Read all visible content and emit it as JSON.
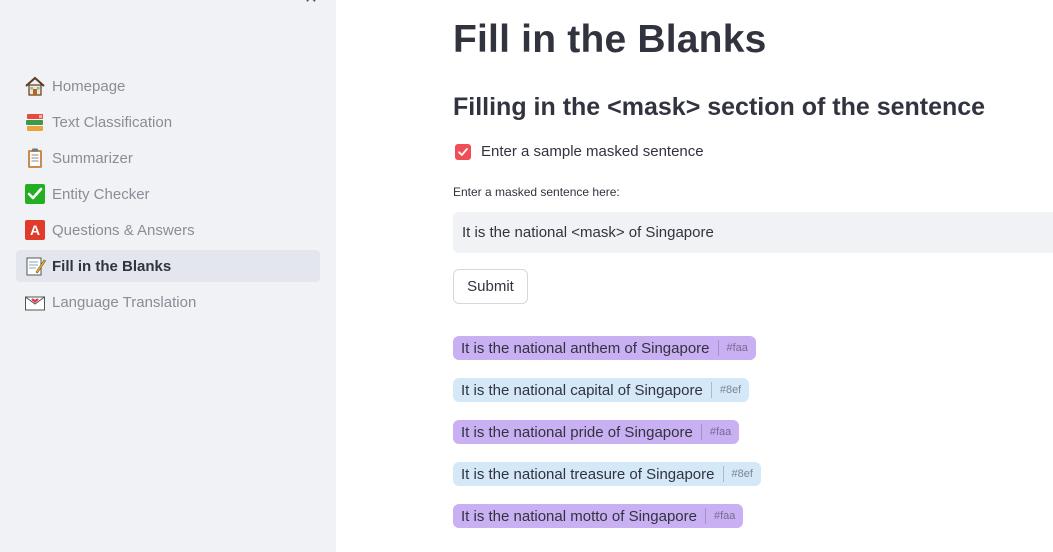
{
  "sidebar": {
    "items": [
      {
        "label": "Homepage",
        "icon": "house-icon",
        "active": false
      },
      {
        "label": "Text Classification",
        "icon": "books-icon",
        "active": false
      },
      {
        "label": "Summarizer",
        "icon": "clipboard-icon",
        "active": false
      },
      {
        "label": "Entity Checker",
        "icon": "check-mark-icon",
        "active": false
      },
      {
        "label": "Questions & Answers",
        "icon": "letter-a-icon",
        "active": false
      },
      {
        "label": "Fill in the Blanks",
        "icon": "memo-icon",
        "active": true
      },
      {
        "label": "Language Translation",
        "icon": "love-letter-icon",
        "active": false
      }
    ]
  },
  "main": {
    "title": "Fill in the Blanks",
    "subtitle": "Filling in the <mask> section of the sentence",
    "checkbox_label": "Enter a sample masked sentence",
    "checkbox_checked": true,
    "input_label": "Enter a masked sentence here:",
    "input_value": "It is the national <mask> of Singapore",
    "submit_label": "Submit",
    "results": [
      {
        "text": "It is the national anthem of Singapore",
        "tag": "#faa",
        "color": "#c9b0f2"
      },
      {
        "text": "It is the national capital of Singapore",
        "tag": "#8ef",
        "color": "#d4e8f8"
      },
      {
        "text": "It is the national pride of Singapore",
        "tag": "#faa",
        "color": "#c9b0f2"
      },
      {
        "text": "It is the national treasure of Singapore",
        "tag": "#8ef",
        "color": "#d4e8f8"
      },
      {
        "text": "It is the national motto of Singapore",
        "tag": "#faa",
        "color": "#c9b0f2"
      }
    ]
  },
  "colors": {
    "sidebar_bg": "#f0f2f6",
    "accent": "#f04d57",
    "text": "#31333f"
  }
}
